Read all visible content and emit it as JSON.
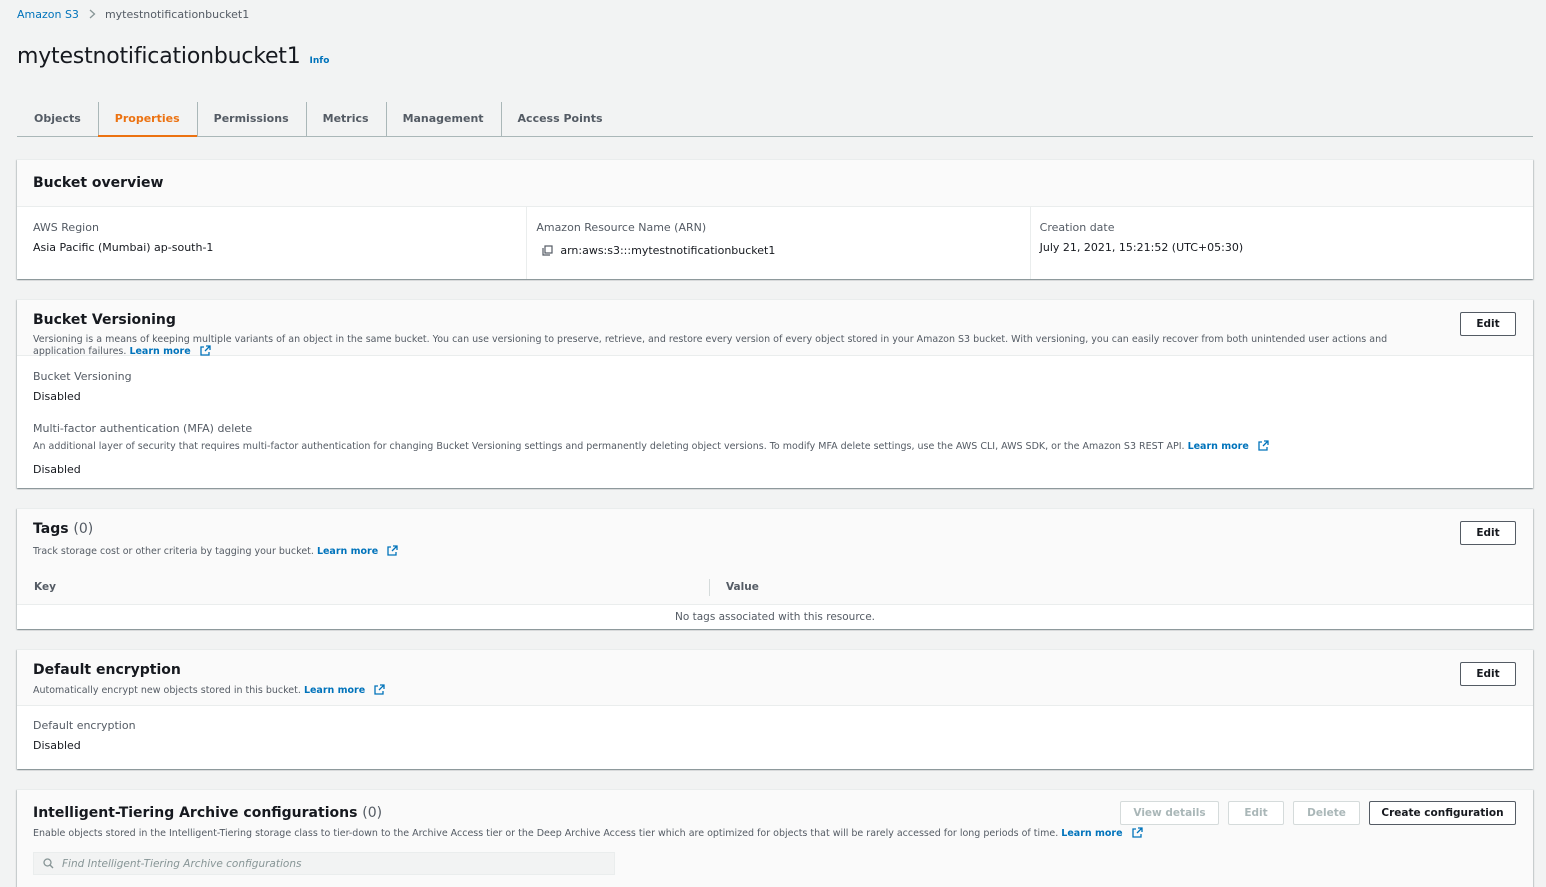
{
  "breadcrumb": {
    "root": "Amazon S3",
    "current": "mytestnotificationbucket1"
  },
  "page": {
    "title": "mytestnotificationbucket1",
    "info": "Info"
  },
  "tabs": [
    {
      "label": "Objects"
    },
    {
      "label": "Properties",
      "active": true
    },
    {
      "label": "Permissions"
    },
    {
      "label": "Metrics"
    },
    {
      "label": "Management"
    },
    {
      "label": "Access Points"
    }
  ],
  "overview": {
    "title": "Bucket overview",
    "region_label": "AWS Region",
    "region_value": "Asia Pacific (Mumbai) ap-south-1",
    "arn_label": "Amazon Resource Name (ARN)",
    "arn_value": "arn:aws:s3:::mytestnotificationbucket1",
    "created_label": "Creation date",
    "created_value": "July 21, 2021, 15:21:52 (UTC+05:30)"
  },
  "versioning": {
    "title": "Bucket Versioning",
    "description": "Versioning is a means of keeping multiple variants of an object in the same bucket. You can use versioning to preserve, retrieve, and restore every version of every object stored in your Amazon S3 bucket. With versioning, you can easily recover from both unintended user actions and application failures.",
    "learn_more": "Learn more",
    "edit": "Edit",
    "status_label": "Bucket Versioning",
    "status_value": "Disabled",
    "mfa_label": "Multi-factor authentication (MFA) delete",
    "mfa_description": "An additional layer of security that requires multi-factor authentication for changing Bucket Versioning settings and permanently deleting object versions. To modify MFA delete settings, use the AWS CLI, AWS SDK, or the Amazon S3 REST API.",
    "mfa_learn_more": "Learn more",
    "mfa_value": "Disabled"
  },
  "tags": {
    "title": "Tags",
    "count": "(0)",
    "description": "Track storage cost or other criteria by tagging your bucket.",
    "learn_more": "Learn more",
    "edit": "Edit",
    "col_key": "Key",
    "col_value": "Value",
    "empty": "No tags associated with this resource."
  },
  "encryption": {
    "title": "Default encryption",
    "description": "Automatically encrypt new objects stored in this bucket.",
    "learn_more": "Learn more",
    "edit": "Edit",
    "label": "Default encryption",
    "value": "Disabled"
  },
  "tiering": {
    "title": "Intelligent-Tiering Archive configurations",
    "count": "(0)",
    "description": "Enable objects stored in the Intelligent-Tiering storage class to tier-down to the Archive Access tier or the Deep Archive Access tier which are optimized for objects that will be rarely accessed for long periods of time.",
    "learn_more": "Learn more",
    "view_details": "View details",
    "edit": "Edit",
    "delete": "Delete",
    "create": "Create configuration",
    "search_placeholder": "Find Intelligent-Tiering Archive configurations"
  },
  "colors": {
    "link": "#0073bb",
    "accent": "#ec7211",
    "background": "#f2f3f3"
  }
}
